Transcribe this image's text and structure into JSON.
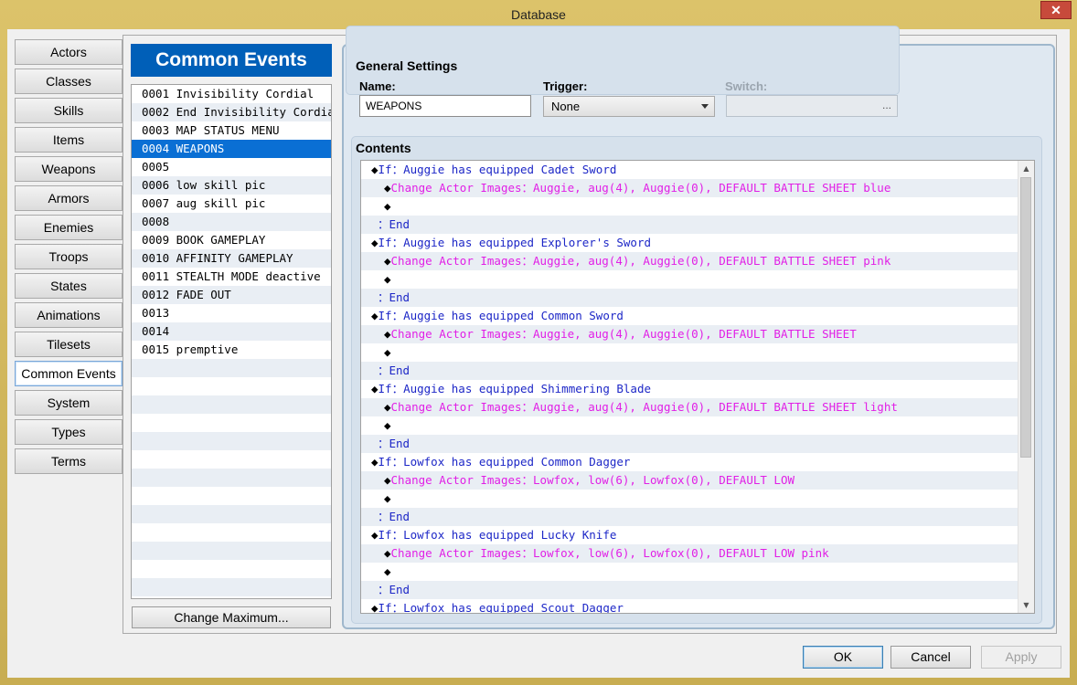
{
  "window": {
    "title": "Database",
    "close_label": "✕"
  },
  "categories": [
    {
      "label": "Actors"
    },
    {
      "label": "Classes"
    },
    {
      "label": "Skills"
    },
    {
      "label": "Items"
    },
    {
      "label": "Weapons"
    },
    {
      "label": "Armors"
    },
    {
      "label": "Enemies"
    },
    {
      "label": "Troops"
    },
    {
      "label": "States"
    },
    {
      "label": "Animations"
    },
    {
      "label": "Tilesets"
    },
    {
      "label": "Common Events"
    },
    {
      "label": "System"
    },
    {
      "label": "Types"
    },
    {
      "label": "Terms"
    }
  ],
  "active_category": "Common Events",
  "event_list": {
    "header": "Common Events",
    "items": [
      "0001 Invisibility Cordial",
      "0002 End Invisibility Cordial",
      "0003 MAP STATUS MENU",
      "0004 WEAPONS",
      "0005",
      "0006 low skill pic",
      "0007 aug skill pic",
      "0008",
      "0009 BOOK GAMEPLAY",
      "0010 AFFINITY GAMEPLAY",
      "0011 STEALTH MODE deactive",
      "0012 FADE OUT",
      "0013",
      "0014",
      "0015 premptive"
    ],
    "selected_index": 3,
    "change_max_label": "Change Maximum..."
  },
  "general_settings": {
    "title": "General Settings",
    "name_label": "Name:",
    "name_value": "WEAPONS",
    "trigger_label": "Trigger:",
    "trigger_value": "None",
    "switch_label": "Switch:",
    "switch_button": "..."
  },
  "contents": {
    "title": "Contents",
    "commands": [
      {
        "type": "if",
        "text": "◆If：Auggie has equipped Cadet Sword"
      },
      {
        "type": "change",
        "text": "◆Change Actor Images：Auggie, aug(4), Auggie(0), DEFAULT BATTLE SHEET blue"
      },
      {
        "type": "blank",
        "text": "◆"
      },
      {
        "type": "end",
        "text": "：End"
      },
      {
        "type": "if",
        "text": "◆If：Auggie has equipped Explorer's Sword"
      },
      {
        "type": "change",
        "text": "◆Change Actor Images：Auggie, aug(4), Auggie(0), DEFAULT BATTLE SHEET pink"
      },
      {
        "type": "blank",
        "text": "◆"
      },
      {
        "type": "end",
        "text": "：End"
      },
      {
        "type": "if",
        "text": "◆If：Auggie has equipped Common Sword"
      },
      {
        "type": "change",
        "text": "◆Change Actor Images：Auggie, aug(4), Auggie(0), DEFAULT BATTLE SHEET"
      },
      {
        "type": "blank",
        "text": "◆"
      },
      {
        "type": "end",
        "text": "：End"
      },
      {
        "type": "if",
        "text": "◆If：Auggie has equipped Shimmering Blade"
      },
      {
        "type": "change",
        "text": "◆Change Actor Images：Auggie, aug(4), Auggie(0), DEFAULT BATTLE SHEET light"
      },
      {
        "type": "blank",
        "text": "◆"
      },
      {
        "type": "end",
        "text": "：End"
      },
      {
        "type": "if",
        "text": "◆If：Lowfox has equipped Common Dagger"
      },
      {
        "type": "change",
        "text": "◆Change Actor Images：Lowfox, low(6), Lowfox(0), DEFAULT LOW"
      },
      {
        "type": "blank",
        "text": "◆"
      },
      {
        "type": "end",
        "text": "：End"
      },
      {
        "type": "if",
        "text": "◆If：Lowfox has equipped Lucky Knife"
      },
      {
        "type": "change",
        "text": "◆Change Actor Images：Lowfox, low(6), Lowfox(0), DEFAULT LOW pink"
      },
      {
        "type": "blank",
        "text": "◆"
      },
      {
        "type": "end",
        "text": "：End"
      },
      {
        "type": "if",
        "text": "◆If：Lowfox has equipped Scout Dagger"
      }
    ],
    "scroll_up": "▲",
    "scroll_down": "▼"
  },
  "footer": {
    "ok_label": "OK",
    "cancel_label": "Cancel",
    "apply_label": "Apply"
  },
  "colors": {
    "if_text": "#1d27c7",
    "change_text": "#e11fe6",
    "selected_row": "#0a6fd4",
    "list_header": "#005fb8"
  }
}
